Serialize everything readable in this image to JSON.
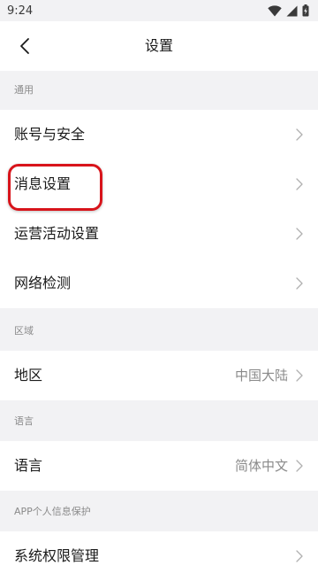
{
  "status_bar": {
    "time": "9:24",
    "icons": [
      "wifi-icon",
      "signal-icon",
      "battery-charging-icon"
    ]
  },
  "header": {
    "title": "设置",
    "back_icon": "chevron-left-icon"
  },
  "sections": {
    "general": {
      "title": "通用",
      "items": [
        {
          "label": "账号与安全"
        },
        {
          "label": "消息设置"
        },
        {
          "label": "运营活动设置"
        },
        {
          "label": "网络检测"
        }
      ]
    },
    "region": {
      "title": "区域",
      "items": [
        {
          "label": "地区",
          "value": "中国大陆"
        }
      ]
    },
    "language": {
      "title": "语言",
      "items": [
        {
          "label": "语言",
          "value": "简体中文"
        }
      ]
    },
    "privacy": {
      "title": "APP个人信息保护",
      "items": [
        {
          "label": "系统权限管理"
        }
      ]
    }
  },
  "colors": {
    "background": "#f2f2f4",
    "row_background": "#ffffff",
    "highlight": "#d8141b",
    "secondary_text": "#8a8a8a"
  }
}
